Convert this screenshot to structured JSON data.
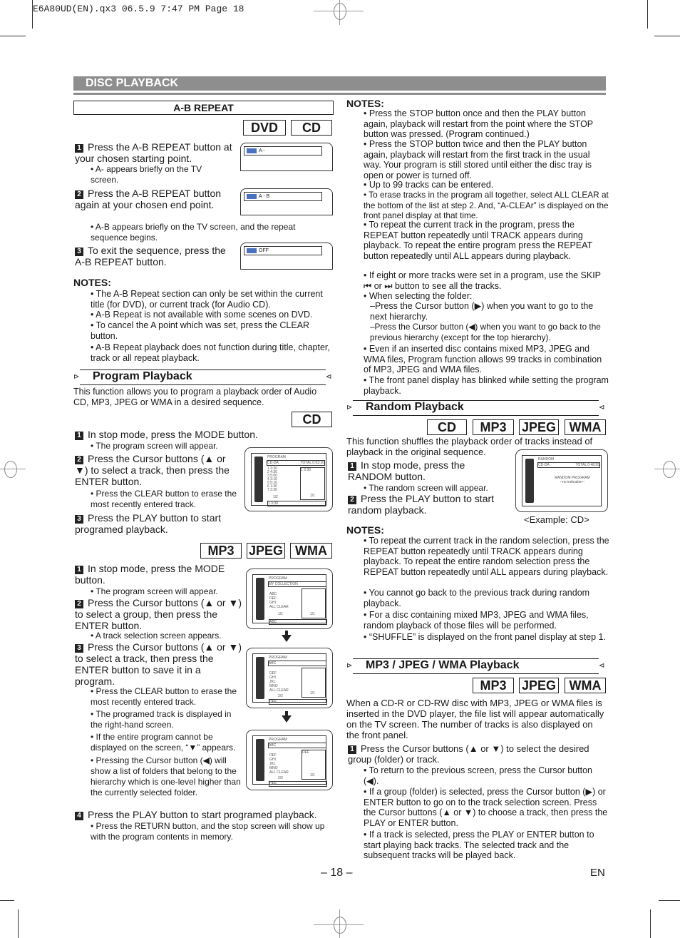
{
  "slug": "E6A80UD(EN).qx3   06.5.9 7:47 PM   Page 18",
  "header": {
    "title": "DISC PLAYBACK"
  },
  "ab_repeat": {
    "title": "A-B REPEAT",
    "tags": [
      "DVD",
      "CD"
    ],
    "steps": [
      {
        "num": "1",
        "text": "Press the A-B REPEAT button at your chosen starting point.",
        "sub": "A- appears briefly on the TV screen.",
        "osd": "A -"
      },
      {
        "num": "2",
        "text": "Press the A-B REPEAT button again at your chosen end point.",
        "sub": "A-B appears briefly on the TV screen, and the repeat sequence begins.",
        "osd": "A - B"
      },
      {
        "num": "3",
        "text": "To exit the sequence, press the A-B REPEAT button.",
        "osd": "OFF"
      }
    ],
    "notes_title": "NOTES:",
    "notes": [
      "The A-B Repeat section can only be set within the current title (for DVD), or current track (for Audio CD).",
      "A-B Repeat is not available with some scenes on DVD.",
      "To cancel the A point which was set, press the CLEAR button.",
      "A-B Repeat playback does not function during title, chapter, track or all repeat playback."
    ]
  },
  "program": {
    "title": "Program Playback",
    "intro": "This function allows you to program a playback order of Audio CD, MP3, JPEG or WMA in a desired sequence.",
    "cd_tag": "CD",
    "cd_steps": [
      {
        "num": "1",
        "text": "In stop mode, press the MODE button.",
        "sub": "The program screen will appear."
      },
      {
        "num": "2",
        "text": "Press the Cursor buttons (▲ or ▼) to select a track, then press the ENTER button.",
        "sub": "Press the CLEAR button to erase the most recently entered track."
      },
      {
        "num": "3",
        "text": "Press the PLAY button to start programed playback."
      }
    ],
    "cd_screen": {
      "title": "PROGRAM",
      "disc": "CD-DA",
      "total": "TOTAL 0:03:30",
      "tracks": [
        "1 3:30",
        "2 4:30",
        "3 5:00",
        "4 3:10",
        "5 5:10",
        "6 1:30",
        "7 2:30"
      ],
      "page": "1/2",
      "right": "1 3:30",
      "right_page": "1/1",
      "bottom": "1 3:30"
    },
    "mp3_tags": [
      "MP3",
      "JPEG",
      "WMA"
    ],
    "mp3_steps": [
      {
        "num": "1",
        "text": "In stop mode, press the MODE button.",
        "sub": "The program screen will appear."
      },
      {
        "num": "2",
        "text": "Press the Cursor buttons (▲ or ▼) to select a group, then press the ENTER button.",
        "sub": "A track selection screen appears."
      },
      {
        "num": "3",
        "text": "Press the Cursor buttons (▲ or ▼) to select a track, then press the ENTER button to save it in a program.",
        "subs": [
          "Press the CLEAR button to erase the most recently entered track.",
          "The programed track is displayed in the right-hand screen.",
          "If the entire program cannot be displayed on the screen, “▼” appears.",
          "Pressing the Cursor button (◀) will show a list of folders that belong to the hierarchy which is one-level higher than the currently selected folder."
        ]
      },
      {
        "num": "4",
        "text": "Press the PLAY button to start programed playback.",
        "sub": "Press the RETURN button, and the stop screen will show up with the program contents in memory."
      }
    ],
    "screens": [
      {
        "title": "PROGRAM",
        "bar": "MY COLLECTION",
        "items": [
          "ABC",
          "DEF",
          "GHI",
          "ALL CLEAR"
        ],
        "page": "1/1",
        "right": "",
        "right_page": "1/1",
        "bottom": "ABC"
      },
      {
        "title": "PROGRAM",
        "bar": "ABC",
        "items": [
          "DEF",
          "GHI",
          "JKL",
          "MNO",
          "ALL CLEAR"
        ],
        "page": "2/2",
        "right": "",
        "right_page": "1/1",
        "bottom": "DEF"
      },
      {
        "title": "PROGRAM",
        "bar": "ABC",
        "items": [
          "DEF",
          "GHI",
          "JKL",
          "MNO",
          "ALL CLEAR"
        ],
        "page": "2/2",
        "right": "DEF",
        "right_page": "1/1",
        "bottom": "DEF"
      }
    ],
    "notes_title": "NOTES:",
    "notes": [
      "Press the STOP button once and then the PLAY button again, playback will restart from the point where the STOP button was pressed. (Program continued.)",
      "Press the STOP button twice and then the PLAY button again, playback will restart from the first track in the usual way. Your program is still stored until either the disc tray is open or power is turned off.",
      "Up to 99 tracks can be entered.",
      "To erase tracks in the program all together, select ALL CLEAR at the bottom of the list at step 2. And, “A-CLEAr” is displayed on the front panel display at that time.",
      "To repeat the current track in the program, press the REPEAT button repeatedly until TRACK appears during playback. To repeat the entire program press the REPEAT button repeatedly until ALL appears during playback.",
      "If eight or more tracks were set in a program, use the SKIP ⏮ or ⏭ button to see all the tracks.",
      "When selecting the folder:",
      "–Press the Cursor button (▶) when you want to go to the next hierarchy.",
      "–Press the Cursor button (◀) when you want to go back to the previous hierarchy (except for the top hierarchy).",
      "Even if an inserted disc contains mixed MP3, JPEG and WMA files, Program function allows 99 tracks in combination of MP3, JPEG and WMA files.",
      "The front panel display has blinked while setting the program playback."
    ]
  },
  "random": {
    "title": "Random Playback",
    "tags": [
      "CD",
      "MP3",
      "JPEG",
      "WMA"
    ],
    "intro": "This function shuffles the playback order of tracks instead of playback in the original sequence.",
    "steps": [
      {
        "num": "1",
        "text": "In stop mode, press the RANDOM button.",
        "sub": "The random screen will appear."
      },
      {
        "num": "2",
        "text": "Press the PLAY button to start random playback."
      }
    ],
    "screen": {
      "title": "RANDOM",
      "disc": "CD-DA",
      "total": "TOTAL 0:48:55",
      "center1": "RANDOM PROGRAM",
      "center2": "--no indication--"
    },
    "caption": "<Example: CD>",
    "notes_title": "NOTES:",
    "notes": [
      "To repeat the current track in the random selection, press the REPEAT button repeatedly until TRACK appears during playback. To repeat the entire random selection press the REPEAT button repeatedly until ALL appears during playback.",
      "You cannot go back to the previous track during random playback.",
      "For a disc containing mixed MP3, JPEG and WMA files, random playback of those files will be performed.",
      "“SHUFFLE” is displayed on the front panel display at step 1."
    ]
  },
  "mp3_playback": {
    "title": "MP3 / JPEG / WMA Playback",
    "tags": [
      "MP3",
      "JPEG",
      "WMA"
    ],
    "intro": "When a CD-R or CD-RW disc with MP3, JPEG or WMA files is inserted in the DVD player, the file list will appear automatically on the TV screen. The number of tracks is also displayed on the front panel.",
    "step": {
      "num": "1",
      "text": "Press the Cursor buttons (▲ or ▼) to select the desired group (folder) or track."
    },
    "subs": [
      "To return to the previous screen, press the Cursor button (◀).",
      "If a group (folder) is selected, press the Cursor button (▶) or ENTER button to go on to the track selection screen. Press the Cursor buttons (▲ or ▼) to choose a track, then press the PLAY or ENTER button.",
      "If a track is selected, press the PLAY or ENTER button to start playing back tracks. The selected track and the subsequent tracks will be played back."
    ]
  },
  "footer": {
    "page": "– 18 –",
    "lang": "EN"
  },
  "colors": {
    "header_bar": "#8e8e8e",
    "osd_icon": "#4a70c0"
  }
}
